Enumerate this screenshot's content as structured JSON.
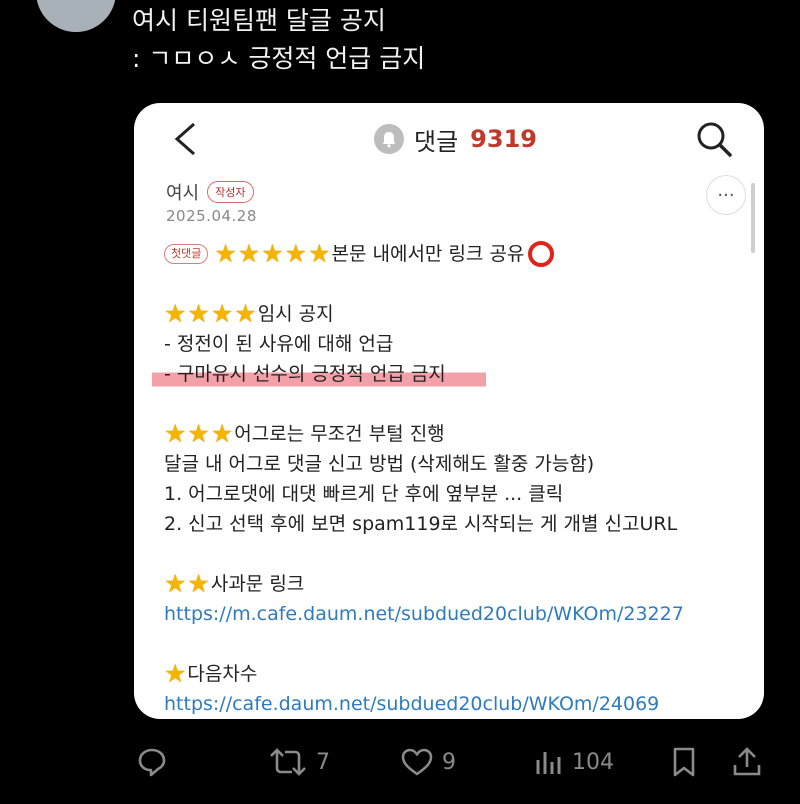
{
  "tweet": {
    "line1": "여시 티원팀팬 달글 공지",
    "line2": ": ㄱㅁㅇㅅ 긍정적 언급 금지"
  },
  "card": {
    "header": {
      "title": "댓글",
      "count": "9319"
    },
    "author": "여시",
    "author_badge": "작성자",
    "date": "2025.04.28",
    "more": "···",
    "first_badge": "첫댓글",
    "lines": {
      "l1": "본문 내에서만 링크 공유",
      "l2": "임시 공지",
      "l3": "- 정전이 된 사유에 대해 언급",
      "l4": "- 구마유시 선수의 긍정적 언급 금지",
      "l5": "어그로는 무조건 부털 진행",
      "l6": "달글 내 어그로 댓글 신고 방법 (삭제해도 활중 가능함)",
      "l7": "1. 어그로댓에 대댓 빠르게 단 후에 옆부분 ... 클릭",
      "l8": "2. 신고 선택 후에 보면 spam119로 시작되는 게 개별 신고URL",
      "l9": "사과문 링크",
      "l10": "https://m.cafe.daum.net/subdued20club/WKOm/23227",
      "l11": "다음차수",
      "l12": "https://cafe.daum.net/subdued20club/WKOm/24069"
    }
  },
  "actions": {
    "retweets": "7",
    "likes": "9",
    "views": "104"
  },
  "icons": [
    "avatar",
    "back-icon",
    "bell-icon",
    "search-icon",
    "more-icon",
    "star-icon",
    "circle-icon",
    "reply-icon",
    "retweet-icon",
    "like-icon",
    "views-icon",
    "bookmark-icon",
    "share-icon"
  ]
}
